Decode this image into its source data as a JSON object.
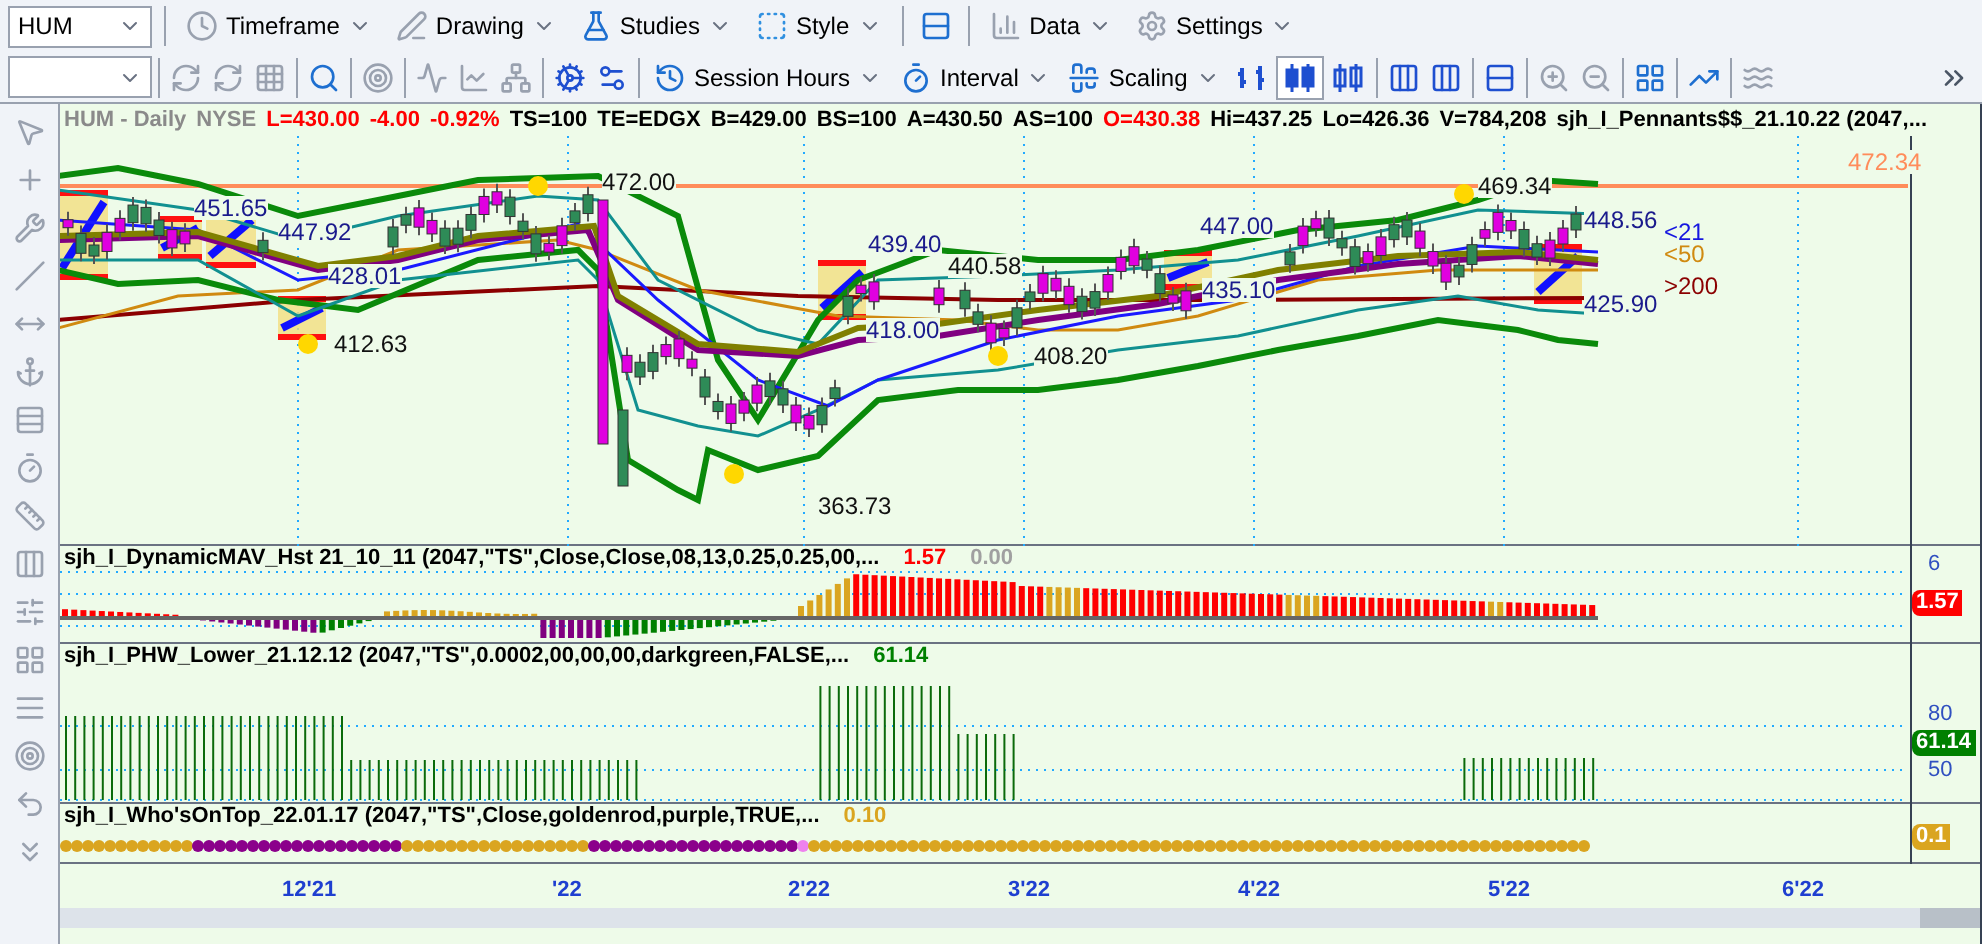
{
  "toolbar_top": {
    "symbol": "HUM",
    "menus": [
      {
        "label": "Timeframe",
        "kind": "clock"
      },
      {
        "label": "Drawing",
        "kind": "pen"
      },
      {
        "label": "Studies",
        "kind": "flask"
      },
      {
        "label": "Style",
        "kind": "style"
      },
      {
        "label": "Data",
        "kind": "data"
      },
      {
        "label": "Settings",
        "kind": "gear"
      }
    ]
  },
  "toolbar_bottom": {
    "menus": [
      {
        "label": "Session Hours",
        "kind": "session"
      },
      {
        "label": "Interval",
        "kind": "interval"
      },
      {
        "label": "Scaling",
        "kind": "scaling"
      }
    ]
  },
  "status_line": [
    {
      "text": "HUM - Daily",
      "color": "#8a8a8a"
    },
    {
      "text": "NYSE",
      "color": "#8a8a8a"
    },
    {
      "text": "L=430.00",
      "color": "#ff0000"
    },
    {
      "text": "-4.00",
      "color": "#ff0000"
    },
    {
      "text": "-0.92%",
      "color": "#ff0000"
    },
    {
      "text": "TS=100",
      "color": "#000000"
    },
    {
      "text": "TE=EDGX",
      "color": "#000000"
    },
    {
      "text": "B=429.00",
      "color": "#000000"
    },
    {
      "text": "BS=100",
      "color": "#000000"
    },
    {
      "text": "A=430.50",
      "color": "#000000"
    },
    {
      "text": "AS=100",
      "color": "#000000"
    },
    {
      "text": "O=430.38",
      "color": "#ff0000"
    },
    {
      "text": "Hi=437.25",
      "color": "#000000"
    },
    {
      "text": "Lo=426.36",
      "color": "#000000"
    },
    {
      "text": "V=784,208",
      "color": "#000000"
    },
    {
      "text": "sjh_I_Pennants$$_21.10.22 (2047,...",
      "color": "#000000"
    }
  ],
  "price_panel": {
    "labels": [
      {
        "text": "451.65",
        "color": "#1a1a8c"
      },
      {
        "text": "447.92",
        "color": "#1a1a8c"
      },
      {
        "text": "428.01",
        "color": "#1a1a8c"
      },
      {
        "text": "412.63",
        "color": "#111111"
      },
      {
        "text": "472.00",
        "color": "#111111"
      },
      {
        "text": "363.73",
        "color": "#111111"
      },
      {
        "text": "439.40",
        "color": "#1a1a8c"
      },
      {
        "text": "418.00",
        "color": "#1a1a8c"
      },
      {
        "text": "440.58",
        "color": "#111111"
      },
      {
        "text": "408.20",
        "color": "#111111"
      },
      {
        "text": "447.00",
        "color": "#1a1a8c"
      },
      {
        "text": "435.10",
        "color": "#1a1a8c"
      },
      {
        "text": "469.34",
        "color": "#111111"
      },
      {
        "text": "448.56",
        "color": "#1a1a8c"
      },
      {
        "text": "425.90",
        "color": "#1a1a8c"
      },
      {
        "text": "<21",
        "color": "#1515e0"
      },
      {
        "text": "<50",
        "color": "#d08a10"
      },
      {
        "text": ">200",
        "color": "#8b0000"
      },
      {
        "text": "472.34",
        "color": "#ff8c5a"
      }
    ]
  },
  "indicators": [
    {
      "kind": "histogram",
      "title": "sjh_I_DynamicMAV_Hst 21_10_11 (2047,\"TS\",Close,Close,08,13,0.25,0.25,00,...",
      "values": [
        {
          "text": "1.57",
          "color": "#ff0000"
        },
        {
          "text": "0.00",
          "color": "#a0a0a0"
        }
      ],
      "axis_labels": [
        "6"
      ],
      "badge": {
        "text": "1.57",
        "color": "#ff0000"
      }
    },
    {
      "kind": "bars",
      "title": "sjh_I_PHW_Lower_21.12.12 (2047,\"TS\",0.0002,00,00,00,darkgreen,FALSE,...",
      "values": [
        {
          "text": "61.14",
          "color": "#008000"
        }
      ],
      "axis_labels": [
        "80",
        "50"
      ],
      "badge": {
        "text": "61.14",
        "color": "#008000"
      }
    },
    {
      "kind": "dots",
      "title": "sjh_I_Who'sOnTop_22.01.17 (2047,\"TS\",Close,goldenrod,purple,TRUE,...",
      "values": [
        {
          "text": "0.10",
          "color": "#daa520"
        }
      ],
      "badge": {
        "text": "0.1",
        "color": "#daa520"
      }
    }
  ],
  "date_axis": [
    "12'21",
    "'22",
    "2'22",
    "3'22",
    "4'22",
    "5'22",
    "6'22"
  ]
}
